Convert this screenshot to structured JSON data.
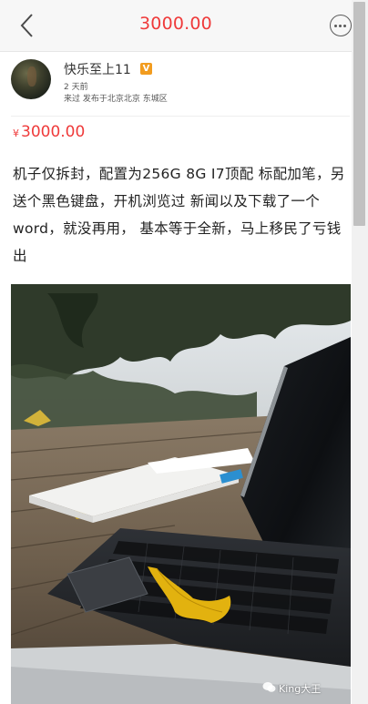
{
  "nav": {
    "title": "3000.00",
    "back_icon": "chevron-left-icon",
    "more_icon": "more-dots-icon"
  },
  "seller": {
    "name": "快乐至上11",
    "badge": "V",
    "time": "2 天前",
    "location": "来过 发布于北京北京 东城区"
  },
  "listing": {
    "price_symbol": "¥",
    "price": "3000.00",
    "description": "机子仅拆封，配置为256G 8G I7顶配 标配加笔，另送个黑色键盘，开机浏览过 新闻以及下载了一个word，就没再用， 基本等于全新，马上移民了亏钱出"
  },
  "photo": {
    "subject": "laptop-with-keyboard-outdoors",
    "watermark": "King大王"
  },
  "colors": {
    "accent": "#ef3a3a",
    "badge": "#f29c1f"
  }
}
